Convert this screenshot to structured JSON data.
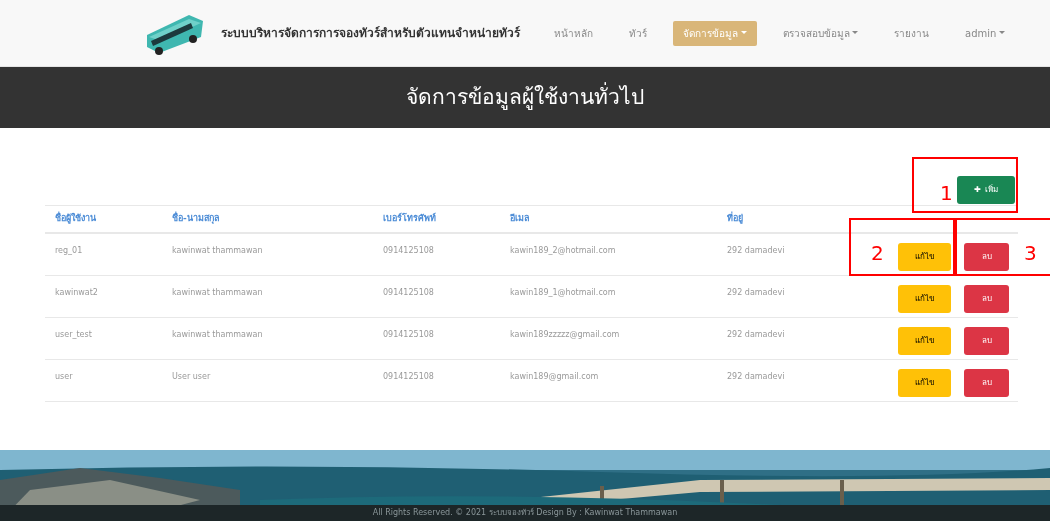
{
  "navbar": {
    "brand": "ระบบบริหารจัดการการจองทัวร์สำหรับตัวแทนจำหน่ายทัวร์",
    "items": [
      {
        "label": "หน้าหลัก",
        "dropdown": false,
        "selected": false
      },
      {
        "label": "ทัวร์",
        "dropdown": false,
        "selected": false
      },
      {
        "label": "จัดการข้อมูล",
        "dropdown": true,
        "selected": true
      },
      {
        "label": "ตรวจสอบข้อมูล",
        "dropdown": true,
        "selected": false
      },
      {
        "label": "รายงาน",
        "dropdown": false,
        "selected": false
      },
      {
        "label": "admin",
        "dropdown": true,
        "selected": false
      }
    ]
  },
  "banner": {
    "title": "จัดการข้อมูลผู้ใช้งานทั่วไป"
  },
  "add_button": {
    "icon": "✚",
    "label": "เพิ่ม"
  },
  "table": {
    "columns": [
      "ชื่อผู้ใช้งาน",
      "ชื่อ-นามสกุล",
      "เบอร์โทรศัพท์",
      "อีเมล",
      "ที่อยู่"
    ],
    "rows": [
      {
        "cells": [
          "reg_01",
          "kawinwat thammawan",
          "0914125108",
          "kawin189_2@hotmail.com",
          "292 damadevi"
        ],
        "edit": "แก้ไข",
        "delete": "ลบ"
      },
      {
        "cells": [
          "kawinwat2",
          "kawinwat thammawan",
          "0914125108",
          "kawin189_1@hotmail.com",
          "292 damadevi"
        ],
        "edit": "แก้ไข",
        "delete": "ลบ"
      },
      {
        "cells": [
          "user_test",
          "kawinwat thammawan",
          "0914125108",
          "kawin189zzzzz@gmail.com",
          "292 damadevi"
        ],
        "edit": "แก้ไข",
        "delete": "ลบ"
      },
      {
        "cells": [
          "user",
          "User user",
          "0914125108",
          "kawin189@gmail.com",
          "292 damadevi"
        ],
        "edit": "แก้ไข",
        "delete": "ลบ"
      }
    ]
  },
  "footer": {
    "kind": "picture",
    "text": "All Rights Reserved. © 2021 ระบบจองทัวร์ Design By : Kawinwat Thammawan"
  },
  "annotations": [
    {
      "label": "1"
    },
    {
      "label": "2"
    },
    {
      "label": "3"
    }
  ]
}
